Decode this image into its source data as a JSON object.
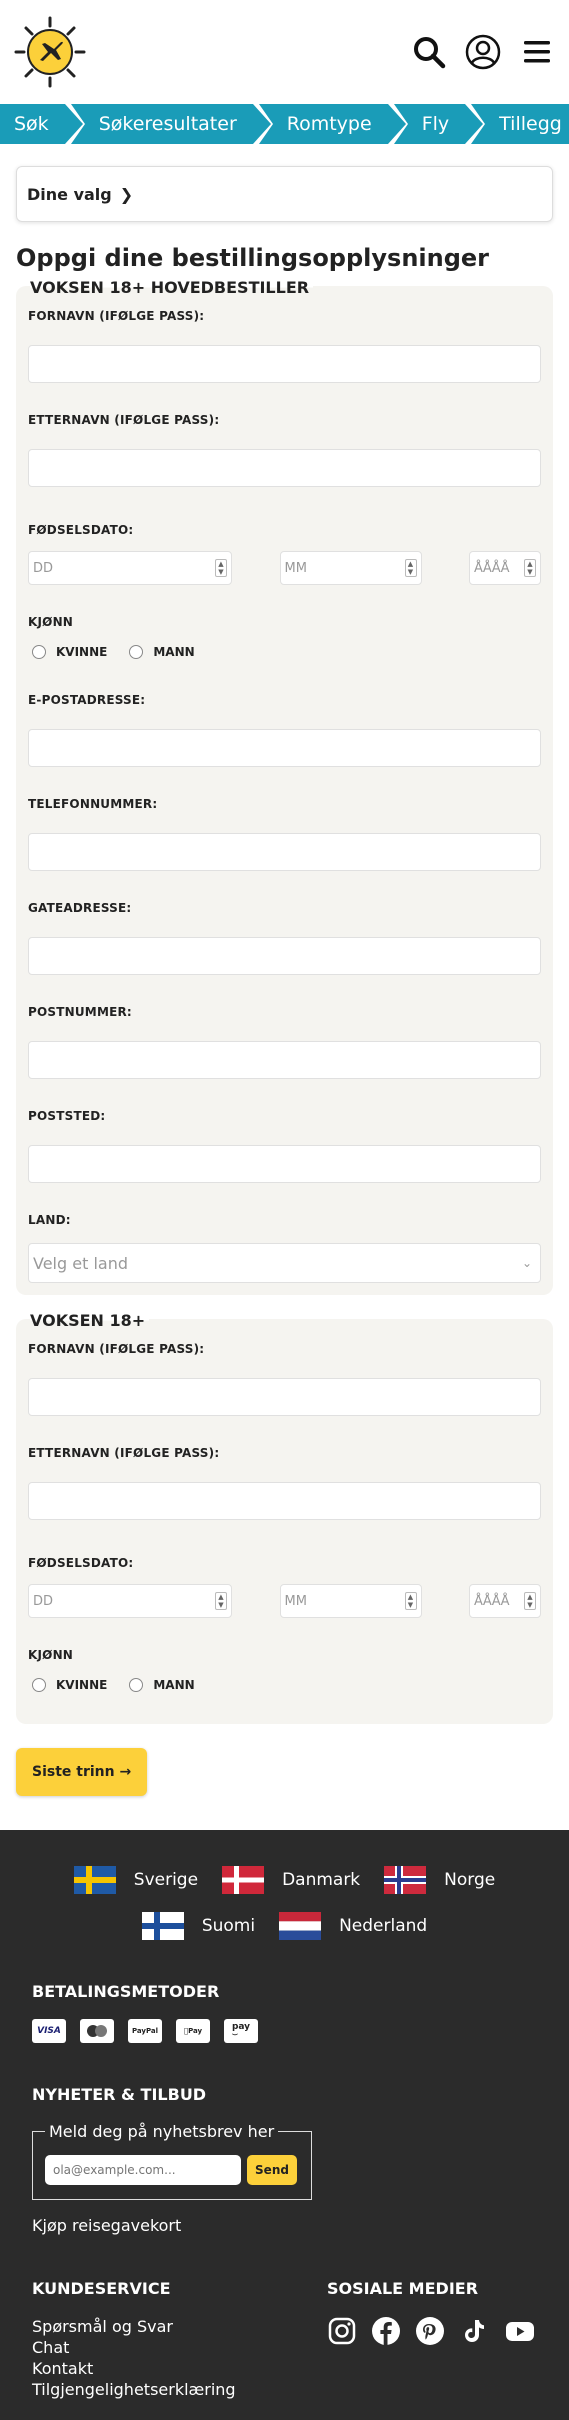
{
  "header": {
    "icons": [
      "plane-sun-logo",
      "search-icon",
      "user-icon",
      "menu-icon"
    ]
  },
  "steps": [
    "Søk",
    "Søkeresultater",
    "Romtype",
    "Fly",
    "Tillegg"
  ],
  "choices_label": "Dine valg",
  "page_title": "Oppgi dine bestillingsopplysninger",
  "main_booker": {
    "title": "VOKSEN 18+ HOVEDBESTILLER",
    "first_name_label": "FORNAVN (IFØLGE PASS):",
    "last_name_label": "ETTERNAVN (IFØLGE PASS):",
    "dob_label": "FØDSELSDATO:",
    "dob_day": "DD",
    "dob_month": "MM",
    "dob_year": "ÅÅÅÅ",
    "gender_label": "KJØNN",
    "female": "KVINNE",
    "male": "MANN",
    "email_label": "E-POSTADRESSE:",
    "phone_label": "TELEFONNUMMER:",
    "street_label": "GATEADRESSE:",
    "postcode_label": "POSTNUMMER:",
    "city_label": "POSTSTED:",
    "country_label": "LAND:",
    "country_placeholder": "Velg et land"
  },
  "adult2": {
    "title": "VOKSEN 18+",
    "first_name_label": "FORNAVN (IFØLGE PASS):",
    "last_name_label": "ETTERNAVN (IFØLGE PASS):",
    "dob_label": "FØDSELSDATO:",
    "dob_day": "DD",
    "dob_month": "MM",
    "dob_year": "ÅÅÅÅ",
    "gender_label": "KJØNN",
    "female": "KVINNE",
    "male": "MANN"
  },
  "next_button": "Siste trinn →",
  "footer": {
    "countries": [
      "Sverige",
      "Danmark",
      "Norge",
      "Suomi",
      "Nederland"
    ],
    "payment_title": "BETALINGSMETODER",
    "payment_methods": [
      "VISA",
      "mastercard",
      "PayPal",
      "Apple Pay",
      "Amazon Pay"
    ],
    "news_title": "NYHETER & TILBUD",
    "newsletter_legend": "Meld deg på nyhetsbrev her",
    "newsletter_placeholder": "ola@example.com...",
    "newsletter_button": "Send",
    "gift_card": "Kjøp reisegavekort",
    "service_title": "KUNDESERVICE",
    "service_links": [
      "Spørsmål og Svar",
      "Chat",
      "Kontakt",
      "Tilgjengelighetserklæring"
    ],
    "social_title": "SOSIALE MEDIER",
    "social_icons": [
      "instagram-icon",
      "facebook-icon",
      "pinterest-icon",
      "tiktok-icon",
      "youtube-icon"
    ]
  },
  "colors": {
    "accent": "#1a9cb8",
    "button": "#fcd03a",
    "footer_bg": "#2b2b2b",
    "card_bg": "#f5f4f0"
  }
}
